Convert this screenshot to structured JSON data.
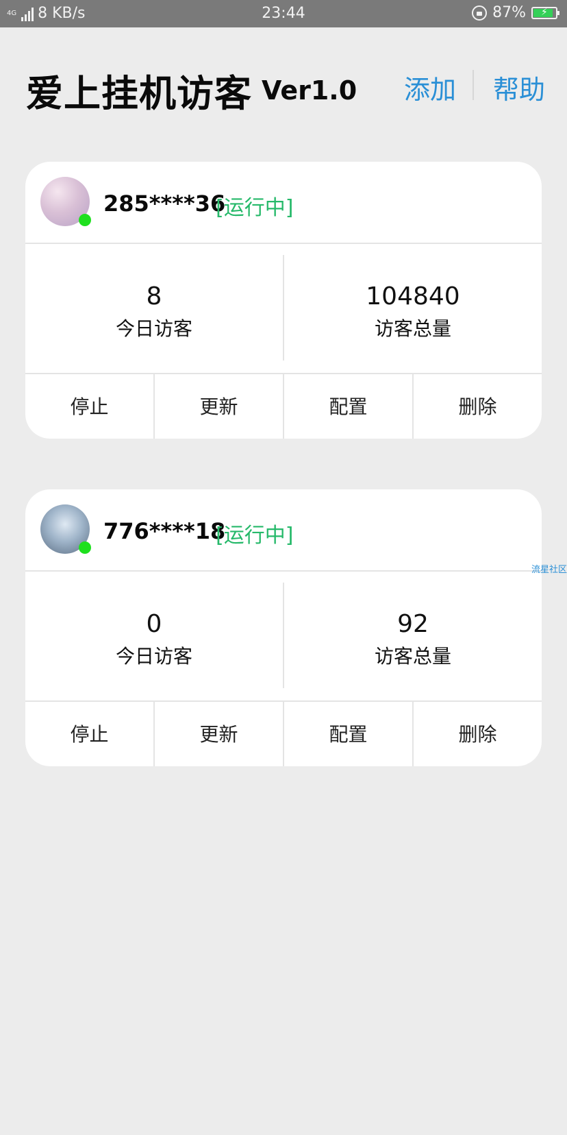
{
  "status_bar": {
    "network": "4G",
    "speed": "8 KB/s",
    "time": "23:44",
    "battery": "87%",
    "battery_level": 0.87
  },
  "header": {
    "title": "爱上挂机访客",
    "version": "Ver1.0",
    "add_label": "添加",
    "help_label": "帮助"
  },
  "accounts": [
    {
      "account": "285****36",
      "status": "[运行中]",
      "today_visitors": "8",
      "today_label": "今日访客",
      "total_visitors": "104840",
      "total_label": "访客总量",
      "actions": [
        "停止",
        "更新",
        "配置",
        "删除"
      ]
    },
    {
      "account": "776****18",
      "status": "[运行中]",
      "today_visitors": "0",
      "today_label": "今日访客",
      "total_visitors": "92",
      "total_label": "访客总量",
      "actions": [
        "停止",
        "更新",
        "配置",
        "删除"
      ]
    }
  ],
  "watermark": "流星社区",
  "colors": {
    "accent": "#2a8fd6",
    "running": "#26b96a",
    "online_dot": "#1ee01e",
    "background": "#ececec"
  }
}
